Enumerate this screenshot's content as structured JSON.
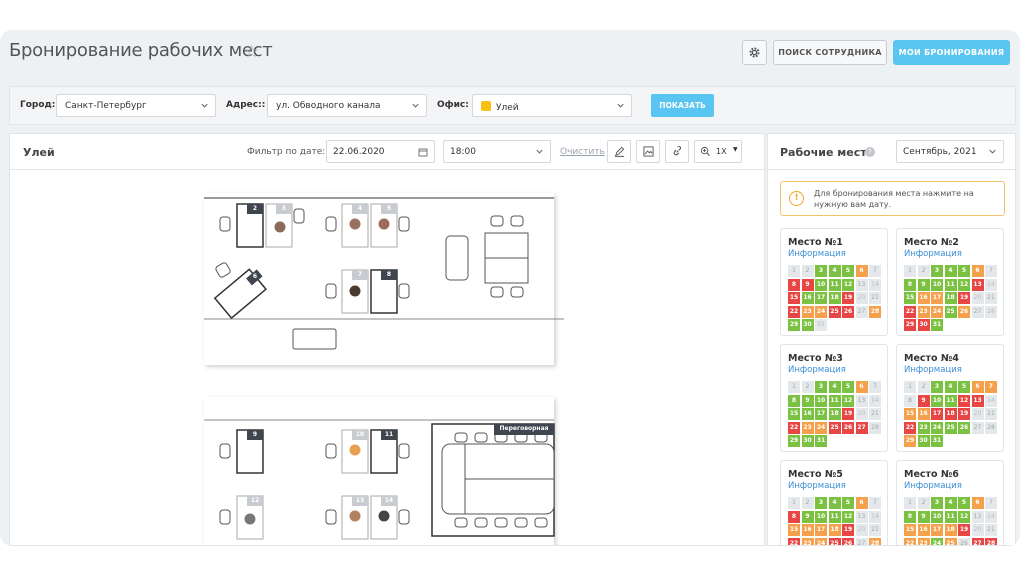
{
  "header": {
    "title": "Бронирование рабочих мест",
    "search_employee": "ПОИСК СОТРУДНИКА",
    "my_bookings": "МОИ БРОНИРОВАНИЯ"
  },
  "filters": {
    "city_label": "Город:",
    "city_value": "Санкт-Петербург",
    "address_label": "Адрес::",
    "address_value": "ул. Обводного канала",
    "office_label": "Офис:",
    "office_value": "Улей",
    "office_color": "#f7c114",
    "show_button": "ПОКАЗАТЬ"
  },
  "map": {
    "title": "Улей",
    "date_filter_label": "Фильтр по дате:",
    "date": "22.06.2020",
    "time": "18:00",
    "clear": "Очистить",
    "zoom": "1X",
    "room_label": "Переговорная",
    "desks": [
      "2",
      "3",
      "4",
      "5",
      "6",
      "7",
      "8",
      "9",
      "10",
      "11",
      "12",
      "13",
      "14"
    ]
  },
  "sidebar": {
    "title": "Рабочие места",
    "month": "Сентябрь, 2021",
    "alert": "Для бронирования места нажмите на нужную вам дату.",
    "info_link": "Информация",
    "places": [
      {
        "name": "Место №1",
        "days": "eegggoerrgggenrgggrneroorreoggn"
      },
      {
        "name": "Место №2",
        "days": "eegggoegggggrngoogrneroogoenrrg"
      },
      {
        "name": "Место №3",
        "days": "eegggoegggggenggggrneroorrreggg"
      },
      {
        "name": "Место №4",
        "days": "eegggooerggrrnoorrrnerggggeeoggr"
      },
      {
        "name": "Место №5",
        "days": "eegggoerggggenoooorneroorreog"
      },
      {
        "name": "Место №6",
        "days": "eegggoegggggenoooorneoogoerrg"
      }
    ]
  }
}
